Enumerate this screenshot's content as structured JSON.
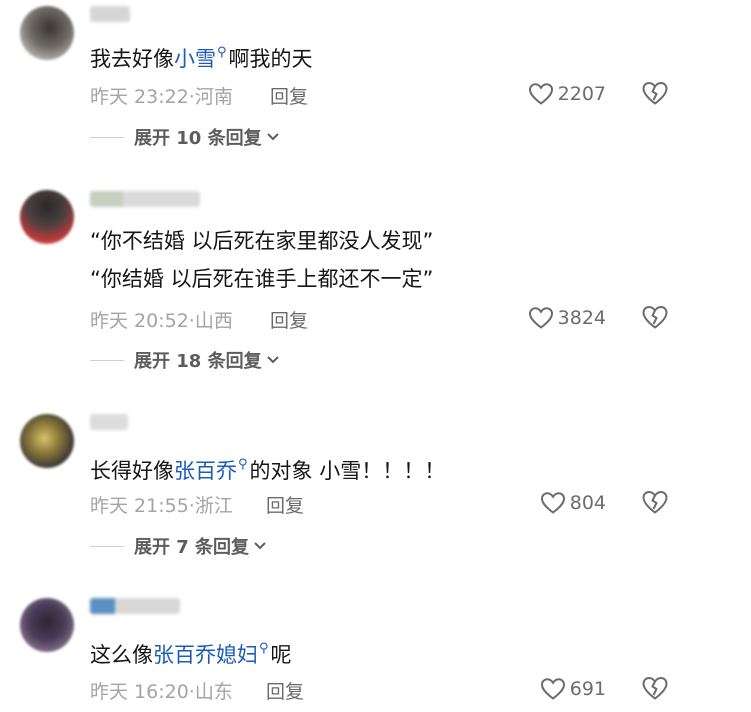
{
  "colors": {
    "highlight": "#1c5bb8",
    "meta": "#a4a4a4",
    "icon": "#6c6c6c"
  },
  "comments": [
    {
      "text_parts": [
        "我去好像",
        "小雪",
        "啊我的天"
      ],
      "date": "昨天 23:22",
      "location": "河南",
      "reply_label": "回复",
      "likes": "2207",
      "expand": "展开 10 条回复"
    },
    {
      "lines": [
        "“你不结婚 以后死在家里都没人发现”",
        "“你结婚 以后死在谁手上都还不一定”"
      ],
      "date": "昨天 20:52",
      "location": "山西",
      "reply_label": "回复",
      "likes": "3824",
      "expand": "展开 18 条回复"
    },
    {
      "text_parts": [
        "长得好像",
        "张百乔",
        "的对象 小雪！！！！"
      ],
      "date": "昨天 21:55",
      "location": "浙江",
      "reply_label": "回复",
      "likes": "804",
      "expand": "展开 7 条回复"
    },
    {
      "text_parts": [
        "这么像",
        "张百乔媳妇",
        "呢"
      ],
      "date": "昨天 16:20",
      "location": "山东",
      "reply_label": "回复",
      "likes": "691"
    }
  ]
}
